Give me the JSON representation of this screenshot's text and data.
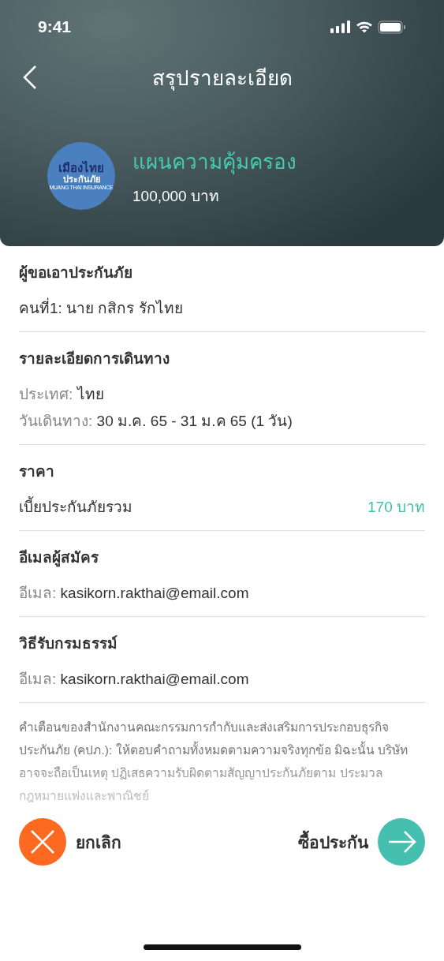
{
  "status_bar": {
    "time": "9:41"
  },
  "header": {
    "title": "สรุปรายละเอียด"
  },
  "plan": {
    "logo_lines": [
      "เมืองไทย",
      "ประกันภัย",
      "MUANG THAI INSURANCE"
    ],
    "name": "แผนความคุ้มครอง",
    "amount": "100,000 บาท"
  },
  "sections": [
    {
      "title": "ผู้ขอเอาประกันภัย",
      "rows": [
        {
          "kind": "plain",
          "text": "คนที่1: นาย กสิกร รักไทย"
        }
      ]
    },
    {
      "title": "รายละเอียดการเดินทาง",
      "rows": [
        {
          "kind": "pair",
          "label": "ประเทศ:",
          "value": "ไทย"
        },
        {
          "kind": "pair",
          "label": "วันเดินทาง:",
          "value": "30 ม.ค. 65 - 31 ม.ค 65 (1 วัน)"
        }
      ]
    },
    {
      "title": "ราคา",
      "rows": [
        {
          "kind": "price",
          "label": "เบี้ยประกันภัยรวม",
          "value": "170 บาท"
        }
      ]
    },
    {
      "title": "อีเมลผู้สมัคร",
      "rows": [
        {
          "kind": "pair",
          "label": "อีเมล:",
          "value": "kasikorn.rakthai@email.com"
        }
      ]
    },
    {
      "title": "วิธีรับกรมธรรม์",
      "rows": [
        {
          "kind": "pair",
          "label": "อีเมล:",
          "value": "kasikorn.rakthai@email.com"
        }
      ]
    }
  ],
  "disclaimer": "คำเตือนของสำนักงานคณะกรรมการกำกับและส่งเสริมการประกอบธุรกิจประกันภัย (คปภ.): ให้ตอบคำถามทั้งหมดตามความจริงทุกข้อ มิฉะนั้น บริษัทอาจจะถือเป็นเหตุ ปฏิเสธความรับผิดตามสัญญาประกันภัยตาม ประมวลกฎหมายแพ่งและพาณิชย์",
  "actions": {
    "cancel": "ยกเลิก",
    "buy": "ซื้อประกัน"
  }
}
